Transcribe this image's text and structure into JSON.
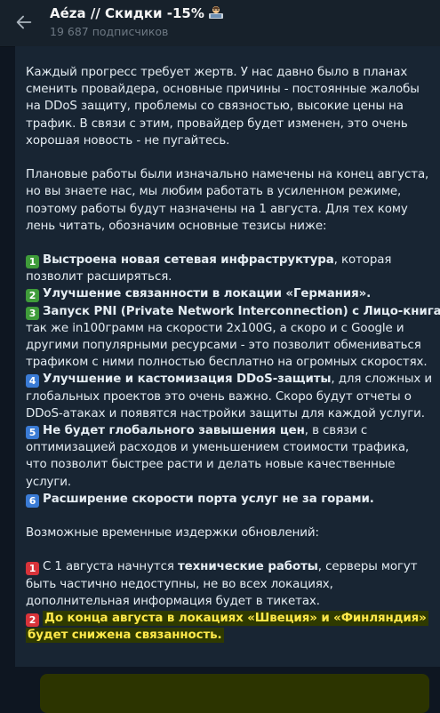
{
  "header": {
    "title": "Aéza // Скидки -15%",
    "subscribers": "19 687 подписчиков"
  },
  "colors": {
    "background": "#0e1621",
    "header": "#17212b",
    "bubble": "#182533",
    "text": "#e4ecf2",
    "highlight_bg": "#2c3400",
    "highlight_text": "#ffe94a",
    "keycap_green": "#3f9c3a",
    "keycap_blue": "#3a7bd5",
    "keycap_red": "#d8333a"
  },
  "icons": {
    "back": "arrow-left-icon",
    "title_emoji": "technologist-emoji-icon",
    "keycap": "number-keycap-icon"
  },
  "post": {
    "p1": [
      "Каждый прогресс требует жертв. У нас давно было в планах",
      "сменить провайдера, основные причины - постоянные жалобы",
      "на DDoS защиту, проблемы со связностью, высокие цены на",
      "трафик. В связи с этим, провайдер будет изменен, это очень",
      "хорошая новость - не пугайтесь."
    ],
    "p2": [
      "Плановые работы были изначально намечены на конец августа,",
      "но вы знаете нас, мы любим работать в усиленном режиме,",
      "поэтому работы будут назначены на 1 августа.  Для тех кому",
      "лень читать, обозначим основные тезисы ниже:"
    ],
    "items": [
      {
        "num": "1",
        "bold": "Выстроена новая сетевая инфраструктура",
        "rest": ", которая",
        "more": [
          "позволит расширяться."
        ]
      },
      {
        "num": "2",
        "bold": "Улучшение связанности в локации «Германия».",
        "rest": "",
        "more": []
      },
      {
        "num": "3",
        "bold": "Запуск PNI (Private Network Interconnection) с Лицо-книга",
        "rest": ", а",
        "more": [
          "так же in100грамм на скорости 2x100G, а скоро и с Google и",
          "другими популярными ресурсами - это позволит обмениваться",
          "трафиком с ними полностью бесплатно на огромных скоростях."
        ]
      },
      {
        "num": "4",
        "bold": "Улучшение и кастомизация DDoS-защиты",
        "rest": ", для сложных и",
        "more": [
          "глобальных проектов это очень важно. Скоро будут отчеты о",
          "DDoS-атаках и появятся настройки защиты для каждой услуги."
        ]
      },
      {
        "num": "5",
        "bold": "Не будет глобального завышения цен",
        "rest": ", в связи с",
        "more": [
          "оптимизацией расходов и уменьшением стоимости трафика,",
          "что позволит быстрее расти и делать новые качественные",
          "услуги."
        ]
      },
      {
        "num": "6",
        "bold": "Расширение скорости порта услуг не за горами.",
        "rest": "",
        "more": []
      }
    ],
    "p3": "Возможные временные издержки обновлений:",
    "risks": [
      {
        "num": "1",
        "pre": "С 1 августа начнутся ",
        "bold": "технические работы",
        "rest": ", серверы могут",
        "more": [
          "быть частично недоступны, не во всех локациях,",
          "дополнительная информация будет в тикетах."
        ]
      },
      {
        "num": "2",
        "hl1": "До конца августа в локациях «Швеция» и «Финляндия»",
        "hl2": "будет снижена связанность."
      }
    ]
  }
}
